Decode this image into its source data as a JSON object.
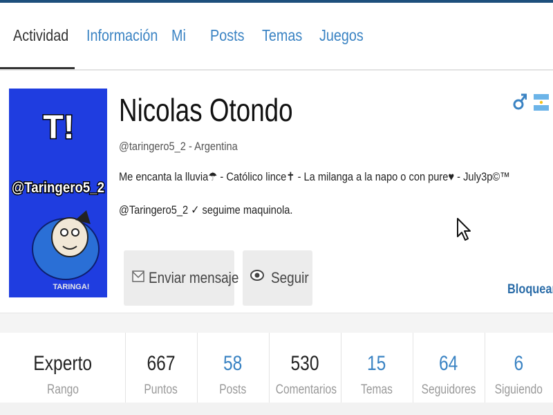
{
  "tabs": [
    {
      "label": "Actividad",
      "active": true
    },
    {
      "label": "Información",
      "active": false
    },
    {
      "label": "Mi",
      "active": false
    },
    {
      "label": "Posts",
      "active": false
    },
    {
      "label": "Temas",
      "active": false
    },
    {
      "label": "Juegos",
      "active": false
    }
  ],
  "profile": {
    "name": "Nicolas Otondo",
    "handle_line": "@taringero5_2 - Argentina",
    "bio_line1": "Me encanta la lluvia☂ - Católico lince✝ - La milanga a la napo o con pure♥ - July3p©™",
    "bio_line2": "@Taringero5_2 ✓ seguime maquinola.",
    "avatar": {
      "big_text": "T!",
      "handle_text": "@Taringero5_2",
      "brand": "TARINGA!"
    },
    "icons": [
      "male-gender-icon",
      "argentina-flag-icon"
    ]
  },
  "actions": {
    "message_label": "Enviar mensaje",
    "follow_label": "Seguir",
    "block_label": "Bloquear"
  },
  "stats": [
    {
      "value": "Experto",
      "label": "Rango"
    },
    {
      "value": "667",
      "label": "Puntos"
    },
    {
      "value": "58",
      "label": "Posts"
    },
    {
      "value": "530",
      "label": "Comentarios"
    },
    {
      "value": "15",
      "label": "Temas"
    },
    {
      "value": "64",
      "label": "Seguidores"
    },
    {
      "value": "6",
      "label": "Siguiendo"
    }
  ],
  "colors": {
    "accent": "#3a83c3",
    "topbar": "#1d4f7c",
    "avatar_bg": "#1f3de0"
  }
}
